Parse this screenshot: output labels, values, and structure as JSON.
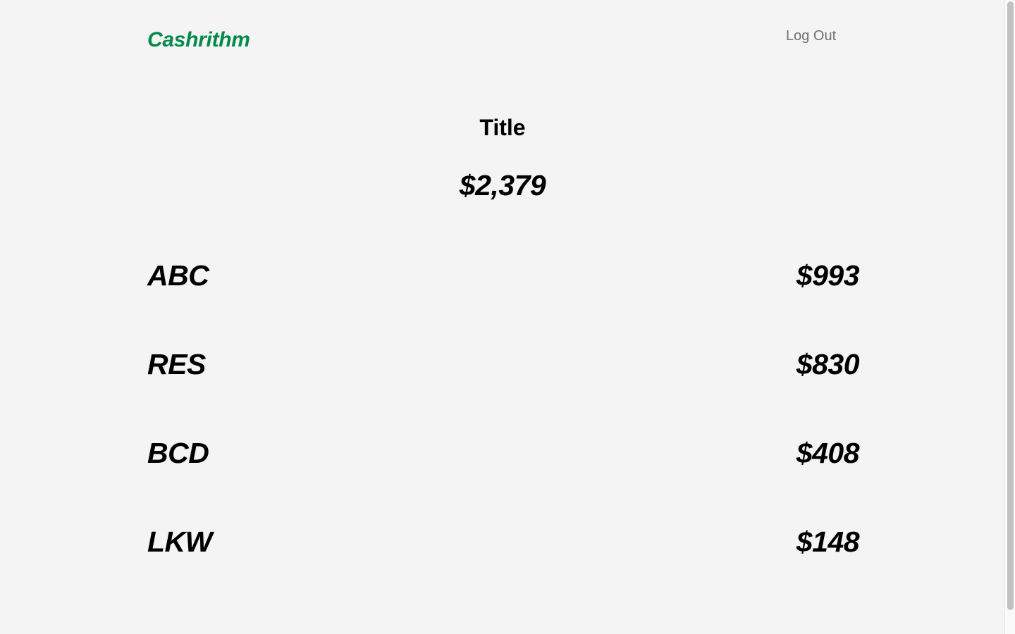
{
  "header": {
    "logo_text": "Cashrithm",
    "logout_label": "Log Out"
  },
  "summary": {
    "title": "Title",
    "total": "$2,379"
  },
  "items": [
    {
      "name": "ABC",
      "amount": "$993"
    },
    {
      "name": "RES",
      "amount": "$830"
    },
    {
      "name": "BCD",
      "amount": "$408"
    },
    {
      "name": "LKW",
      "amount": "$148"
    }
  ],
  "colors": {
    "brand": "#00894a",
    "background": "#f4f4f4",
    "muted_text": "#6f6f6f"
  }
}
